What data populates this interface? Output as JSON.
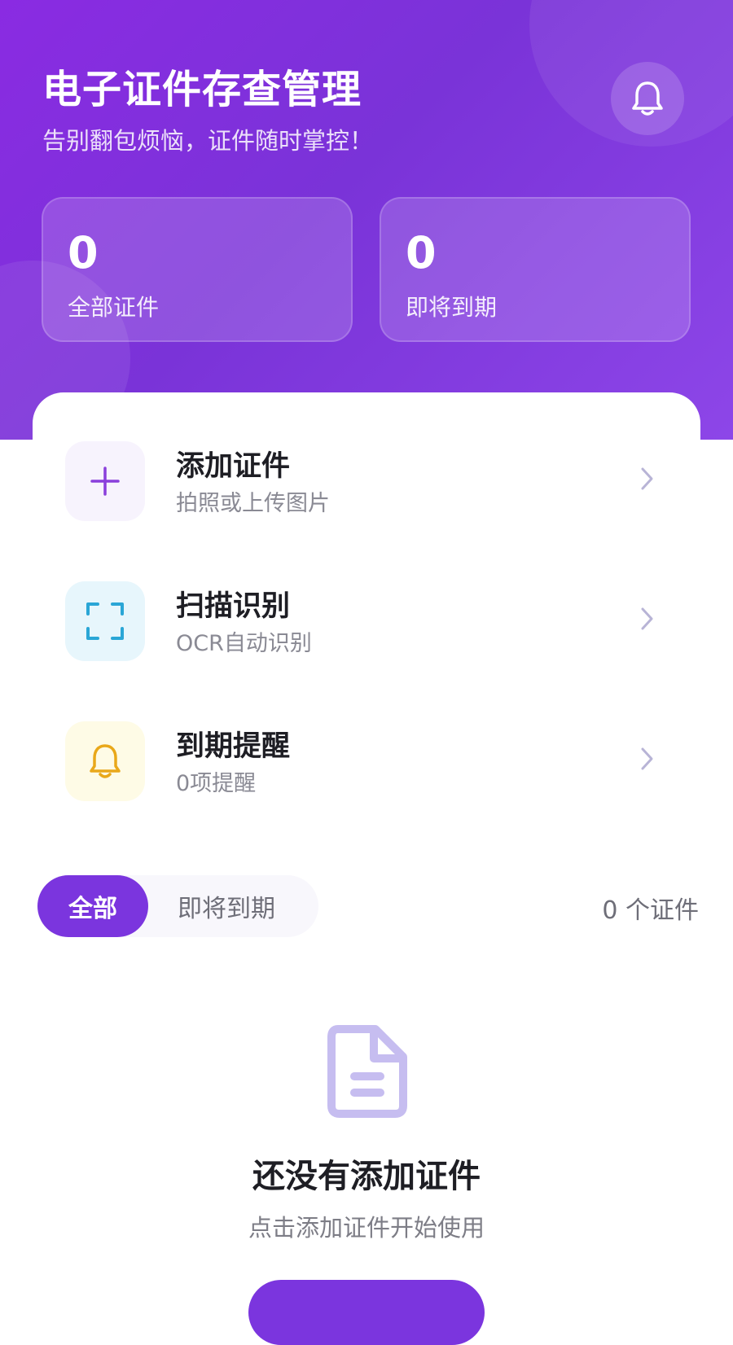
{
  "header": {
    "title": "电子证件存查管理",
    "subtitle": "告别翻包烦恼，证件随时掌控！",
    "bell_icon": "bell-icon"
  },
  "stats": [
    {
      "value": "0",
      "label": "全部证件"
    },
    {
      "value": "0",
      "label": "即将到期"
    }
  ],
  "actions": [
    {
      "title": "添加证件",
      "desc": "拍照或上传图片",
      "icon": "plus-icon",
      "color": "#8a3fdb"
    },
    {
      "title": "扫描识别",
      "desc": "OCR自动识别",
      "icon": "scan-icon",
      "color": "#2aa6d6"
    },
    {
      "title": "到期提醒",
      "desc": "0项提醒",
      "icon": "bell-icon",
      "color": "#e9a81a"
    }
  ],
  "filters": {
    "all": "全部",
    "expiring": "即将到期",
    "count_text": "0 个证件"
  },
  "empty_state": {
    "icon": "document-icon",
    "title": "还没有添加证件",
    "desc": "点击添加证件开始使用"
  },
  "colors": {
    "primary": "#7b35de",
    "header_gradient_start": "#8a2be2",
    "header_gradient_end": "#8d46e8"
  }
}
